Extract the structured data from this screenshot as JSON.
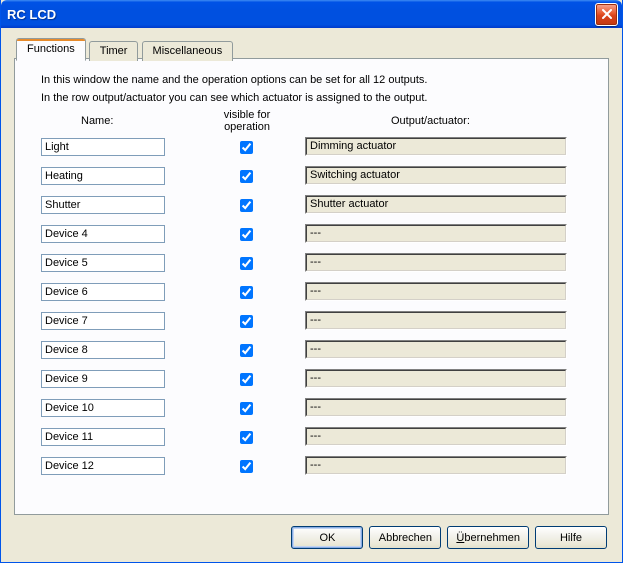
{
  "window": {
    "title": "RC LCD"
  },
  "tabs": [
    {
      "label": "Functions",
      "active": true
    },
    {
      "label": "Timer",
      "active": false
    },
    {
      "label": "Miscellaneous",
      "active": false
    }
  ],
  "intro": {
    "line1": "In this window the name and the operation options can be set for all 12 outputs.",
    "line2": "In the row output/actuator you can see which actuator is assigned to the output."
  },
  "headers": {
    "name": "Name:",
    "visible_line1": "visible for",
    "visible_line2": "operation",
    "output": "Output/actuator:"
  },
  "rows": [
    {
      "name": "Light",
      "visible": true,
      "output": "Dimming actuator"
    },
    {
      "name": "Heating",
      "visible": true,
      "output": "Switching actuator"
    },
    {
      "name": "Shutter",
      "visible": true,
      "output": "Shutter actuator"
    },
    {
      "name": "Device 4",
      "visible": true,
      "output": "---"
    },
    {
      "name": "Device 5",
      "visible": true,
      "output": "---"
    },
    {
      "name": "Device 6",
      "visible": true,
      "output": "---"
    },
    {
      "name": "Device 7",
      "visible": true,
      "output": "---"
    },
    {
      "name": "Device 8",
      "visible": true,
      "output": "---"
    },
    {
      "name": "Device 9",
      "visible": true,
      "output": "---"
    },
    {
      "name": "Device 10",
      "visible": true,
      "output": "---"
    },
    {
      "name": "Device 11",
      "visible": true,
      "output": "---"
    },
    {
      "name": "Device 12",
      "visible": true,
      "output": "---"
    }
  ],
  "buttons": {
    "ok": "OK",
    "cancel": "Abbrechen",
    "apply_prefix": "Ü",
    "apply_rest": "bernehmen",
    "help": "Hilfe"
  }
}
